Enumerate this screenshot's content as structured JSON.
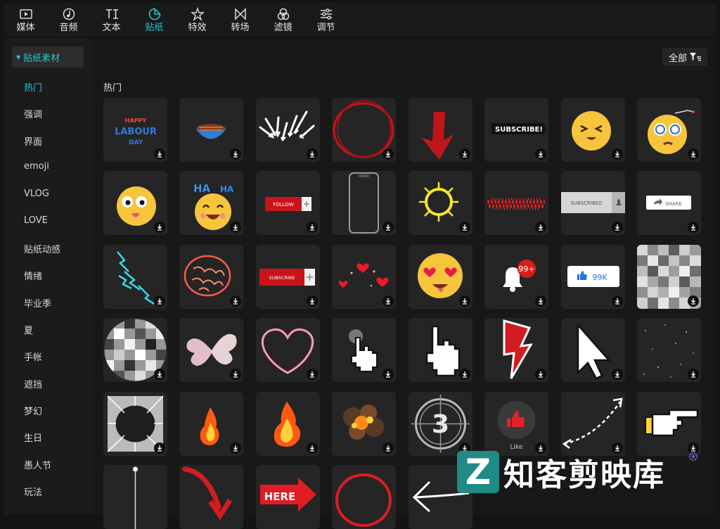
{
  "toolbar": {
    "tabs": [
      {
        "label": "媒体",
        "icon": "media-icon"
      },
      {
        "label": "音频",
        "icon": "audio-icon"
      },
      {
        "label": "文本",
        "icon": "text-icon"
      },
      {
        "label": "贴纸",
        "icon": "sticker-icon",
        "active": true
      },
      {
        "label": "特效",
        "icon": "effects-icon"
      },
      {
        "label": "转场",
        "icon": "transition-icon"
      },
      {
        "label": "滤镜",
        "icon": "filter-icon"
      },
      {
        "label": "调节",
        "icon": "adjust-icon"
      }
    ]
  },
  "sidebar": {
    "header": "贴纸素材",
    "items": [
      "热门",
      "强调",
      "界面",
      "emoji",
      "VLOG",
      "LOVE",
      "贴纸动感",
      "情绪",
      "毕业季",
      "夏",
      "手帐",
      "遮挡",
      "梦幻",
      "生日",
      "愚人节",
      "玩法"
    ]
  },
  "main": {
    "filter_label": "全部",
    "section_title": "热门"
  },
  "stickers": {
    "labour_line1": "HAPPY",
    "labour_line2": "LABOUR",
    "labour_line3": "DAY",
    "subscribe_text": "SUBSCRIBE!",
    "ha_text": "HA",
    "follow_text": "FOLLOW",
    "subscribed_text": "SUBSCRIBED",
    "share_text": "SHARE",
    "subscribe_btn_text": "SUBSCRIBE",
    "badge_99": "99+",
    "like_count": "99K",
    "countdown_number": "3",
    "like_text": "Like",
    "here_text": "HERE"
  },
  "watermark": {
    "logo_letter": "Z",
    "text": "知客剪映库"
  },
  "colors": {
    "accent": "#24c4cf",
    "background": "#141414",
    "tile": "#252525"
  }
}
